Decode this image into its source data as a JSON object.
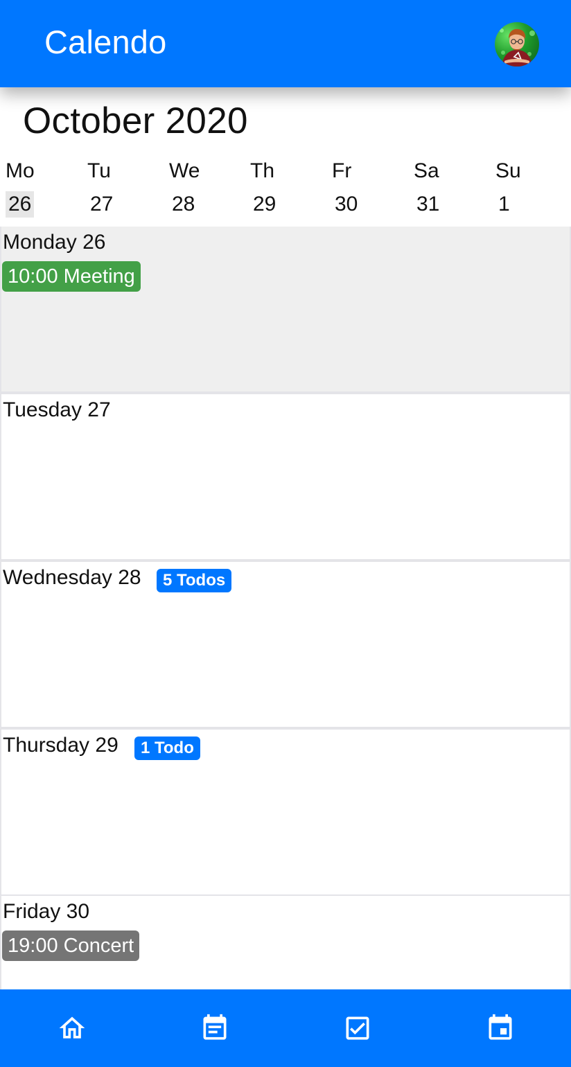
{
  "app": {
    "title": "Calendo"
  },
  "month_title": "October 2020",
  "week": [
    {
      "name": "Mo",
      "date": "26",
      "selected": true
    },
    {
      "name": "Tu",
      "date": "27"
    },
    {
      "name": "We",
      "date": "28"
    },
    {
      "name": "Th",
      "date": "29"
    },
    {
      "name": "Fr",
      "date": "30"
    },
    {
      "name": "Sa",
      "date": "31"
    },
    {
      "name": "Su",
      "date": "1"
    }
  ],
  "days": [
    {
      "heading": "Monday 26",
      "today": true,
      "event": {
        "label": "10:00 Meeting",
        "color": "#43a047"
      }
    },
    {
      "heading": "Tuesday 27"
    },
    {
      "heading": "Wednesday 28",
      "todos": "5 Todos"
    },
    {
      "heading": "Thursday 29",
      "todos": "1 Todo"
    },
    {
      "heading": "Friday 30",
      "event": {
        "label": "19:00 Concert",
        "color": "#757575"
      }
    }
  ],
  "bottom_nav": [
    {
      "icon": "home-icon"
    },
    {
      "icon": "calendar-agenda-icon"
    },
    {
      "icon": "checkbox-icon"
    },
    {
      "icon": "calendar-today-icon"
    }
  ],
  "colors": {
    "primary": "#0077ff",
    "event_green": "#43a047",
    "event_grey": "#757575",
    "today_bg": "#efefef"
  }
}
